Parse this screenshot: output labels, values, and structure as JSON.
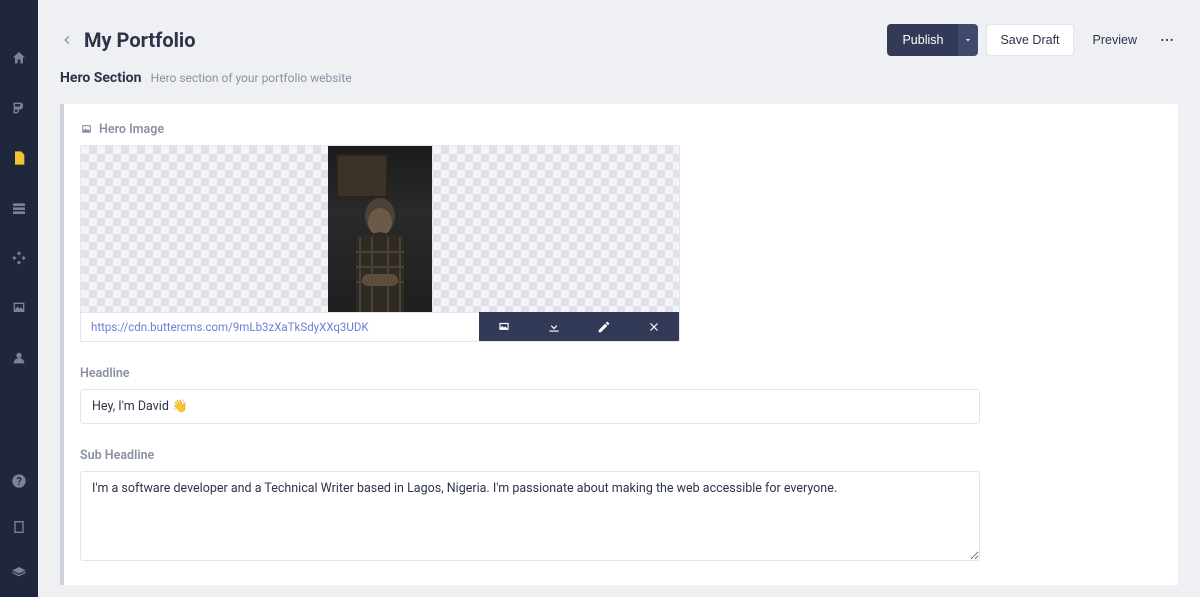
{
  "header": {
    "title": "My Portfolio",
    "actions": {
      "publish": "Publish",
      "save_draft": "Save Draft",
      "preview": "Preview"
    }
  },
  "section": {
    "title": "Hero Section",
    "description": "Hero section of your portfolio website"
  },
  "hero_image": {
    "label": "Hero Image",
    "url": "https://cdn.buttercms.com/9mLb3zXaTkSdyXXq3UDK"
  },
  "fields": {
    "headline": {
      "label": "Headline",
      "value": "Hey, I'm David 👋"
    },
    "sub_headline": {
      "label": "Sub Headline",
      "value": "I'm a software developer and a Technical Writer based in Lagos, Nigeria. I'm passionate about making the web accessible for everyone."
    }
  }
}
